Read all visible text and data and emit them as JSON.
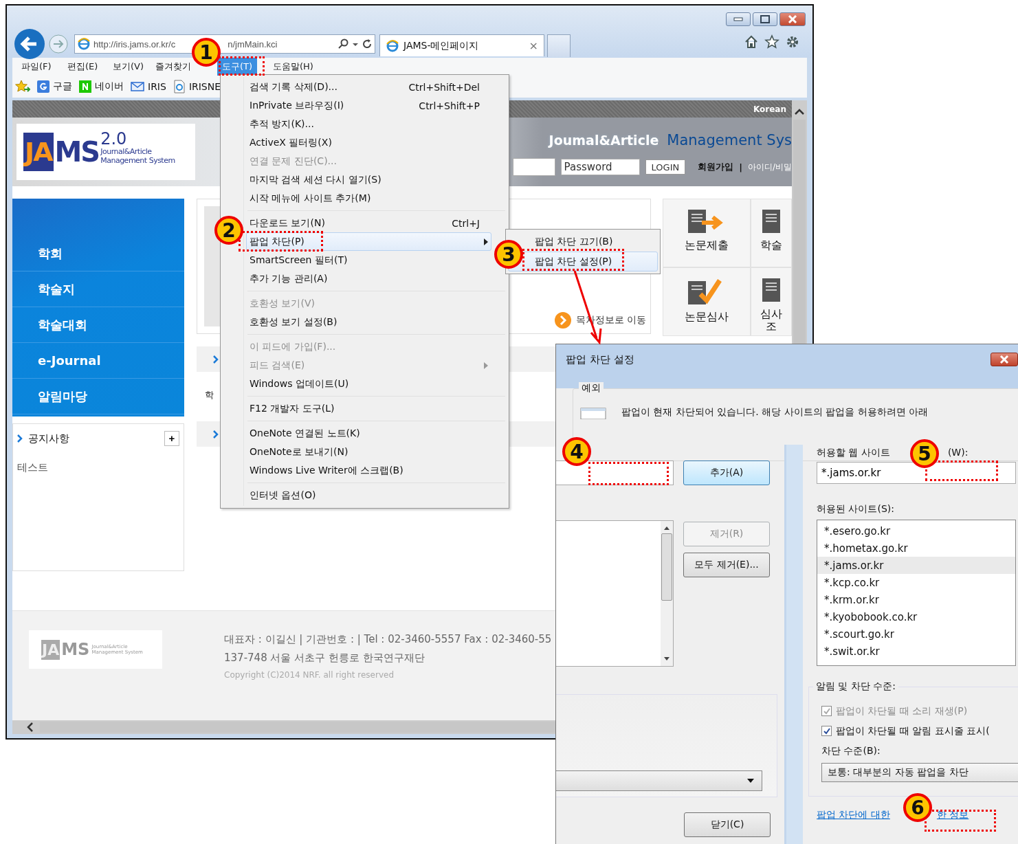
{
  "window": {
    "address": [
      "http://iris.jams.or.kr/c",
      "n/jmMain.kci"
    ],
    "tab": {
      "title": "JAMS-메인페이지",
      "close": "×"
    }
  },
  "menubar": [
    {
      "label": "파일(F)",
      "selected": false
    },
    {
      "label": "편집(E)",
      "selected": false
    },
    {
      "label": "보기(V)",
      "selected": false
    },
    {
      "label": "즐겨찾기",
      "selected": false
    },
    {
      "label": "도구(T)",
      "selected": true
    },
    {
      "label": "도움말(H)",
      "selected": false
    }
  ],
  "favorites": [
    {
      "label": "구글",
      "kind": "google"
    },
    {
      "label": "네이버",
      "kind": "naver"
    },
    {
      "label": "IRIS",
      "kind": "mail"
    },
    {
      "label": "IRISNE",
      "kind": "page"
    }
  ],
  "page": {
    "language": "Korean",
    "logo": {
      "letters": [
        "JA",
        "MS"
      ],
      "version": "2.0",
      "subtitle": [
        "Journal&Article",
        "Management System"
      ]
    },
    "header_title": [
      "Joumal&Article",
      "Management Sys"
    ],
    "password_placeholder": "Password",
    "login": "LOGIN",
    "links": [
      "회원가입",
      "|",
      "아이디/비밀"
    ],
    "nav": [
      "학회",
      "학술지",
      "학술대회",
      "e-Journal",
      "알림마당"
    ],
    "notice": {
      "title": "공지사항",
      "more": "+",
      "items": [
        "테스트"
      ]
    },
    "toc_link": "목차정보로 이동",
    "row_fragment": "학",
    "tiles": [
      {
        "lines": [
          "논문제출"
        ],
        "kind": "submit"
      },
      {
        "lines": [
          "학술"
        ],
        "kind": "doc"
      },
      {
        "lines": [
          "논문심사"
        ],
        "kind": "review"
      },
      {
        "lines": [
          "심사",
          "조"
        ],
        "kind": "doc"
      }
    ],
    "footer": {
      "logo": {
        "letters": [
          "JA",
          "MS"
        ],
        "subtitle": [
          "Journal&Article",
          "Management System"
        ]
      },
      "lines": [
        "대표자 : 이길신 | 기관번호 : | Tel : 02-3460-5557 Fax : 02-3460-55",
        "137-748 서울 서초구 헌릉로 한국연구재단",
        "Copyright (C)2014 NRF. all right reserved"
      ]
    }
  },
  "tools_menu": [
    [
      {
        "label": "검색 기록 삭제(D)...",
        "shortcut": "Ctrl+Shift+Del",
        "disabled": false,
        "selected": false,
        "submenu": false
      },
      {
        "label": "InPrivate 브라우징(I)",
        "shortcut": "Ctrl+Shift+P",
        "disabled": false,
        "selected": false,
        "submenu": false
      },
      {
        "label": "추적 방지(K)...",
        "disabled": false,
        "selected": false,
        "submenu": false
      },
      {
        "label": "ActiveX 필터링(X)",
        "disabled": false,
        "selected": false,
        "submenu": false
      },
      {
        "label": "연결 문제 진단(C)...",
        "disabled": true,
        "selected": false,
        "submenu": false
      },
      {
        "label": "마지막 검색 세션 다시 열기(S)",
        "disabled": false,
        "selected": false,
        "submenu": false
      },
      {
        "label": "시작 메뉴에 사이트 추가(M)",
        "disabled": false,
        "selected": false,
        "submenu": false
      }
    ],
    [
      {
        "label": "다운로드 보기(N)",
        "shortcut": "Ctrl+J",
        "disabled": false,
        "selected": false,
        "submenu": false
      },
      {
        "label": "팝업 차단(P)",
        "disabled": false,
        "selected": true,
        "submenu": true
      },
      {
        "label": "SmartScreen 필터(T)",
        "disabled": false,
        "selected": false,
        "submenu": false
      },
      {
        "label": "추가 기능 관리(A)",
        "disabled": false,
        "selected": false,
        "submenu": false
      }
    ],
    [
      {
        "label": "호환성 보기(V)",
        "disabled": true,
        "selected": false,
        "submenu": false
      },
      {
        "label": "호환성 보기 설정(B)",
        "disabled": false,
        "selected": false,
        "submenu": false
      }
    ],
    [
      {
        "label": "이 피드에 가입(F)...",
        "disabled": true,
        "selected": false,
        "submenu": false
      },
      {
        "label": "피드 검색(E)",
        "disabled": true,
        "selected": false,
        "submenu": true
      },
      {
        "label": "Windows 업데이트(U)",
        "disabled": false,
        "selected": false,
        "submenu": false
      }
    ],
    [
      {
        "label": "F12 개발자 도구(L)",
        "disabled": false,
        "selected": false,
        "submenu": false
      }
    ],
    [
      {
        "label": "OneNote 연결된 노트(K)",
        "disabled": false,
        "selected": false,
        "submenu": false
      },
      {
        "label": "OneNote로 보내기(N)",
        "disabled": false,
        "selected": false,
        "submenu": false
      },
      {
        "label": "Windows Live Writer에 스크랩(B)",
        "disabled": false,
        "selected": false,
        "submenu": false
      }
    ],
    [
      {
        "label": "인터넷 옵션(O)",
        "disabled": false,
        "selected": false,
        "submenu": false
      }
    ]
  ],
  "submenu": [
    {
      "label": "팝업 차단 끄기(B)",
      "selected": false
    },
    {
      "label": "팝업 차단 설정(P)",
      "selected": true
    }
  ],
  "dialog": {
    "title": "팝업 차단 설정",
    "group_title": "예외",
    "notice": "팝업이 현재 차단되어 있습니다. 해당 사이트의 팝업을 허용하려면 아래",
    "add": "추가(A)",
    "remove": {
      "label": "제거(R)",
      "disabled": true
    },
    "remove_all": "모두 제거(E)...",
    "close_button": "닫기(C)",
    "address_label": [
      "허용할 웹 사이트",
      "(W):"
    ],
    "address_value": "*.jams.or.kr",
    "allowed_label": "허용된 사이트(S):",
    "allowed": [
      {
        "site": "*.esero.go.kr",
        "selected": false
      },
      {
        "site": "*.hometax.go.kr",
        "selected": false
      },
      {
        "site": "*.jams.or.kr",
        "selected": true
      },
      {
        "site": "*.kcp.co.kr",
        "selected": false
      },
      {
        "site": "*.krm.or.kr",
        "selected": false
      },
      {
        "site": "*.kyobobook.co.kr",
        "selected": false
      },
      {
        "site": "*.scourt.go.kr",
        "selected": false
      },
      {
        "site": "*.swit.or.kr",
        "selected": false
      }
    ],
    "notify_title": "알림 및 차단 수준:",
    "checks": [
      {
        "label": "팝업이 차단될 때 소리 재생(P)",
        "checked": true,
        "disabled": true
      },
      {
        "label": "팝업이 차단될 때 알림 표시줄 표시(",
        "checked": true,
        "disabled": false
      }
    ],
    "level_label": "차단 수준(B):",
    "level_value": "보통: 대부분의 자동 팝업을 차단",
    "link": [
      "팝업 차단에 대한",
      "한 정보"
    ]
  },
  "annotations": [
    "1",
    "2",
    "3",
    "4",
    "5",
    "6"
  ]
}
